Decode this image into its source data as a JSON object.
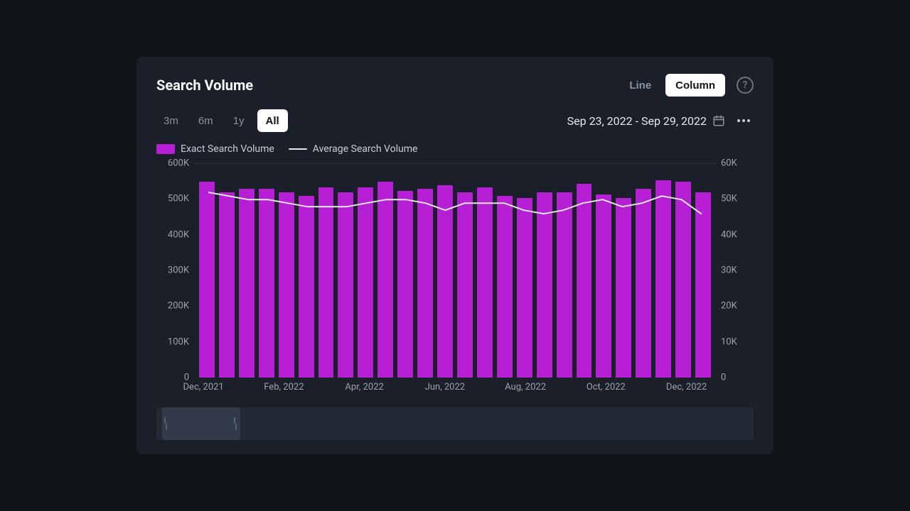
{
  "card": {
    "title": "Search Volume"
  },
  "chart_type_toggle": {
    "options": [
      {
        "label": "Line",
        "active": false
      },
      {
        "label": "Column",
        "active": true
      }
    ]
  },
  "range_tabs": [
    {
      "key": "3m",
      "label": "3m",
      "active": false
    },
    {
      "key": "6m",
      "label": "6m",
      "active": false
    },
    {
      "key": "1y",
      "label": "1y",
      "active": false
    },
    {
      "key": "all",
      "label": "All",
      "active": true
    }
  ],
  "date_range": {
    "label": "Sep 23, 2022 - Sep 29, 2022"
  },
  "legend": {
    "bar": "Exact Search Volume",
    "line": "Average Search Volume"
  },
  "chart_data": {
    "type": "bar",
    "title": "Search Volume",
    "xlabel": "",
    "ylabel_left": "Exact Search Volume",
    "ylabel_right": "Average Search Volume",
    "ylim_left": [
      0,
      600000
    ],
    "ylim_right": [
      0,
      60000
    ],
    "y_ticks_left": [
      "600K",
      "500K",
      "400K",
      "300K",
      "200K",
      "100K",
      "0"
    ],
    "y_ticks_right": [
      "60K",
      "50K",
      "40K",
      "30K",
      "20K",
      "10K",
      "0"
    ],
    "x_tick_labels": [
      "Dec, 2021",
      "Feb, 2022",
      "Apr, 2022",
      "Jun, 2022",
      "Aug, 2022",
      "Oct, 2022",
      "Dec, 2022"
    ],
    "x_tick_indexes": [
      0,
      4,
      8,
      12,
      16,
      20,
      24
    ],
    "series": [
      {
        "name": "Exact Search Volume",
        "kind": "bar",
        "axis": "left",
        "values": [
          550000,
          520000,
          530000,
          530000,
          520000,
          510000,
          535000,
          520000,
          535000,
          550000,
          525000,
          530000,
          540000,
          520000,
          535000,
          510000,
          505000,
          520000,
          520000,
          545000,
          515000,
          505000,
          530000,
          555000,
          550000,
          520000
        ]
      },
      {
        "name": "Average Search Volume",
        "kind": "line",
        "axis": "right",
        "values": [
          52000,
          51000,
          50000,
          50000,
          49000,
          48000,
          48000,
          48000,
          49000,
          50000,
          50000,
          49000,
          47000,
          49000,
          49000,
          49000,
          47000,
          46000,
          47000,
          49000,
          50000,
          48000,
          49000,
          51000,
          50000,
          46000
        ]
      }
    ],
    "legend_position": "top-left",
    "grid": false
  }
}
